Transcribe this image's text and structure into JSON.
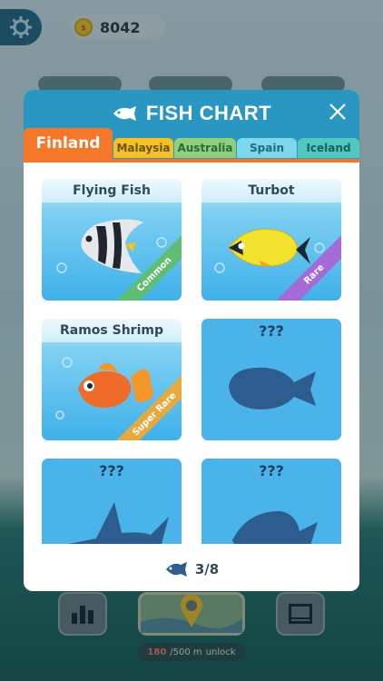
{
  "hud": {
    "coins": "8042",
    "coin_symbol": "$"
  },
  "modal": {
    "title": "FISH CHART",
    "tabs": [
      {
        "label": "Finland",
        "active": true,
        "color": "#f4772a"
      },
      {
        "label": "Malaysia",
        "color": "#f4c12a"
      },
      {
        "label": "Australia",
        "color": "#8fce7e"
      },
      {
        "label": "Spain",
        "color": "#7ed6ea"
      },
      {
        "label": "Iceland",
        "color": "#4fc8c1"
      }
    ],
    "cards": [
      {
        "name": "Flying Fish",
        "rarity": "Common",
        "rarity_color": "#5fbe73",
        "known": true
      },
      {
        "name": "Turbot",
        "rarity": "Rare",
        "rarity_color": "#a569d8",
        "known": true
      },
      {
        "name": "Ramos Shrimp",
        "rarity": "Super Rare",
        "rarity_color": "#e7a93d",
        "known": true
      },
      {
        "name": "???",
        "known": false
      },
      {
        "name": "???",
        "known": false
      },
      {
        "name": "???",
        "known": false
      }
    ],
    "progress": "3/8"
  },
  "bottom": {
    "unlock_current": "180",
    "unlock_total": "/500 m",
    "unlock_label": "unlock"
  }
}
